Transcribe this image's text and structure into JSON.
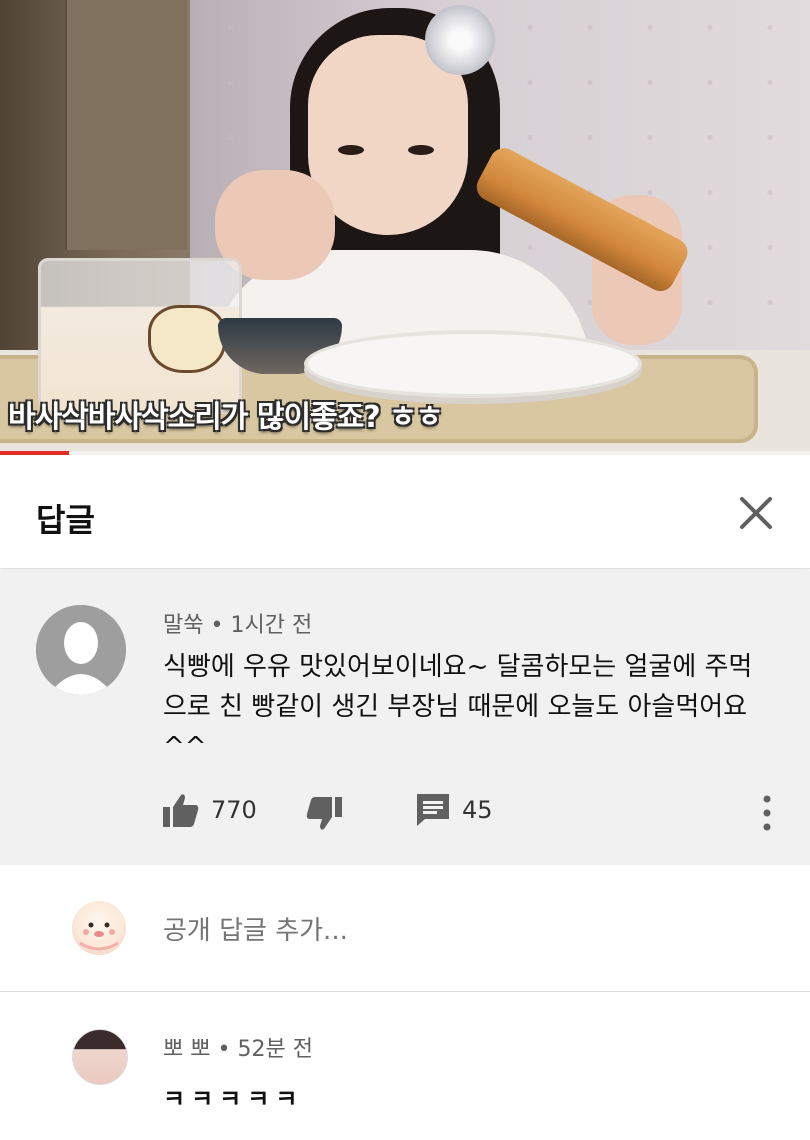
{
  "video": {
    "caption": "바사삭바사삭소리가 많이좋죠? ㅎㅎ",
    "progress_fraction": 0.085
  },
  "replies_panel": {
    "title": "답글",
    "close_icon": "close-icon"
  },
  "parent_comment": {
    "author": "말쑥",
    "time": "1시간 전",
    "text": "식빵에 우유 맛있어보이네요~ 달콤하모는 얼굴에 주먹으로 친 빵같이 생긴 부장님 때문에 오늘도 아슬먹어요^^",
    "likes": "770",
    "reply_count": "45",
    "icons": [
      "thumbs-up-icon",
      "thumbs-down-icon",
      "comment-icon",
      "more-vert-icon"
    ]
  },
  "add_reply": {
    "placeholder": "공개 답글 추가..."
  },
  "replies": [
    {
      "author": "뽀 뽀",
      "time": "52분 전",
      "text": "ㅋㅋㅋㅋㅋ"
    }
  ],
  "colors": {
    "progress": "#e52d27",
    "comment_bg": "#f1f1f1",
    "meta_text": "#606060"
  }
}
